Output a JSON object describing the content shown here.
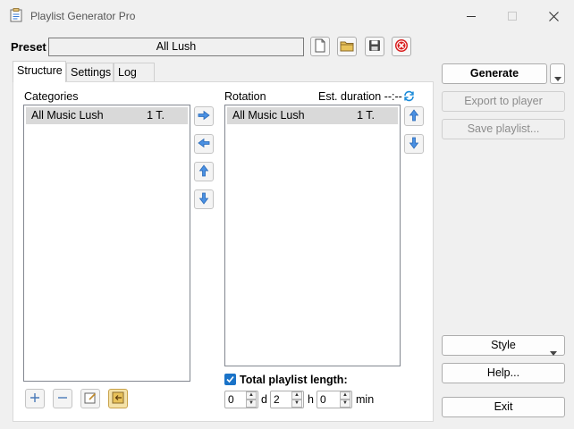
{
  "window": {
    "title": "Playlist Generator Pro",
    "minimize_icon": "minimize-icon",
    "maximize_icon": "maximize-icon",
    "close_icon": "close-icon"
  },
  "preset": {
    "label": "Preset",
    "value": "All Lush"
  },
  "tabs": [
    {
      "label": "Structure",
      "active": true
    },
    {
      "label": "Settings",
      "active": false
    },
    {
      "label": "Log",
      "active": false
    }
  ],
  "categories": {
    "label": "Categories",
    "items": [
      {
        "name": "All Music Lush",
        "count": "1 T."
      }
    ]
  },
  "rotation": {
    "label": "Rotation",
    "duration_label": "Est. duration --:--",
    "items": [
      {
        "name": "All Music Lush",
        "count": "1 T."
      }
    ]
  },
  "total_length": {
    "label": "Total playlist length:",
    "checked": true,
    "days": "0",
    "days_unit": "d",
    "hours": "2",
    "hours_unit": "h",
    "minutes": "0",
    "minutes_unit": "min"
  },
  "actions": {
    "generate": "Generate",
    "export": "Export to player",
    "save": "Save playlist...",
    "style": "Style",
    "help": "Help...",
    "exit": "Exit"
  },
  "colors": {
    "accent": "#1a73c8",
    "delete_red": "#d92020",
    "folder_yellow": "#e8c25a"
  }
}
